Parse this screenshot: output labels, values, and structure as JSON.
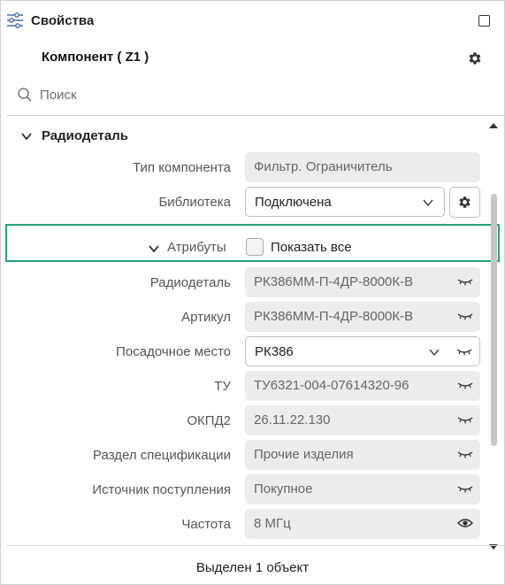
{
  "panel": {
    "title": "Свойства",
    "icon": "sliders-icon",
    "maximize_icon": "maximize-icon"
  },
  "component": {
    "title": "Компонент ( Z1 )",
    "settings_icon": "gear-icon"
  },
  "search": {
    "placeholder": "Поиск",
    "value": ""
  },
  "section": {
    "title": "Радиодеталь",
    "expanded": true
  },
  "rows": {
    "component_type": {
      "label": "Тип компонента",
      "value": "Фильтр. Ограничитель"
    },
    "library": {
      "label": "Библиотека",
      "value": "Подключена"
    }
  },
  "attributes": {
    "label": "Атрибуты",
    "show_all_label": "Показать все",
    "show_all_checked": false
  },
  "attr_rows": [
    {
      "label": "Радиодеталь",
      "value": "РК386ММ-П-4ДР-8000К-В",
      "visibility": "eye-closed-icon"
    },
    {
      "label": "Артикул",
      "value": "РК386ММ-П-4ДР-8000К-В",
      "visibility": "eye-closed-icon"
    },
    {
      "label": "Посадочное место",
      "value": "РК386",
      "visibility": "eye-closed-icon"
    },
    {
      "label": "ТУ",
      "value": "ТУ6321-004-07614320-96",
      "visibility": "eye-closed-icon"
    },
    {
      "label": "ОКПД2",
      "value": "26.11.22.130",
      "visibility": "eye-closed-icon"
    },
    {
      "label": "Раздел спецификации",
      "value": "Прочие изделия",
      "visibility": "eye-closed-icon"
    },
    {
      "label": "Источник поступления",
      "value": "Покупное",
      "visibility": "eye-closed-icon"
    },
    {
      "label": "Частота",
      "value": "8 МГц",
      "visibility": "eye-open-icon"
    }
  ],
  "status": {
    "text": "Выделен 1 объект"
  },
  "colors": {
    "highlight": "#26a07f",
    "field_bg": "#ececec"
  }
}
